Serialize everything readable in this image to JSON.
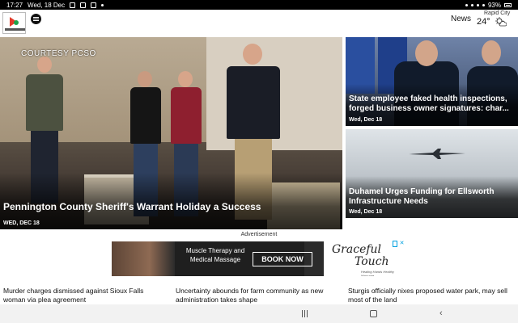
{
  "status_bar": {
    "time": "17:27",
    "date": "Wed, 18 Dec",
    "battery": "93%"
  },
  "header": {
    "nav_label": "News",
    "weather": {
      "city": "Rapid City",
      "temperature": "24°",
      "icon": "partly-sunny-icon"
    }
  },
  "hero": {
    "credit": "COURTESY PCSO",
    "title": "Pennington County Sheriff's Warrant Holiday a Success",
    "date": "WED, DEC 18"
  },
  "side_stories": [
    {
      "title": "State employee faked health inspections, forged business owner signatures: char...",
      "date": "Wed, Dec 18"
    },
    {
      "title": "Duhamel Urges Funding for Ellsworth Infrastructure Needs",
      "date": "Wed, Dec 18"
    }
  ],
  "ad": {
    "label": "Advertisement",
    "text": "Muscle Therapy and Medical Massage",
    "button": "BOOK NOW",
    "brand_line1": "Graceful",
    "brand_line2": "Touch",
    "tagline": "Healing Hands Healthy Massage"
  },
  "headlines": [
    "Murder charges dismissed against Sioux Falls woman via plea agreement",
    "Uncertainty abounds for farm community as new administration takes shape",
    "Sturgis officially nixes proposed water park, may sell most of the land"
  ],
  "colors": {
    "status_bar": "#000000",
    "nav_bar": "#f2f2f2",
    "ad_accent": "#00a1e0"
  }
}
